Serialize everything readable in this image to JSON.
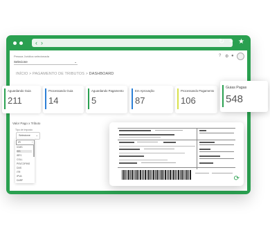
{
  "browser": {
    "nav_back": "‹",
    "nav_forward": "›",
    "toolbar_icons": [
      "reload-icon",
      "add-icon",
      "star-icon"
    ]
  },
  "header": {
    "profile_caption": "Pessoa Jurídica selecionada",
    "company_select_value": "Selecione",
    "icons": [
      "help-icon",
      "settings-icon",
      "notifications-icon"
    ]
  },
  "breadcrumb": {
    "items": [
      "INÍCIO",
      "PAGAMENTO DE TRIBUTOS"
    ],
    "separator": ">",
    "current": "DASHBOARD"
  },
  "cards": [
    {
      "label": "Aguardando Guia",
      "value": "211",
      "color": "#2aa050"
    },
    {
      "label": "Processando Guia",
      "value": "14",
      "color": "#2b7fd6"
    },
    {
      "label": "Aguardando Pagamento",
      "value": "5",
      "color": "#2aa050"
    },
    {
      "label": "Em Aprovação",
      "value": "87",
      "color": "#2b7fd6"
    },
    {
      "label": "Processando Pagamento",
      "value": "106",
      "color": "#d8e04a"
    },
    {
      "label": "Guias Pagas",
      "value": "548",
      "color": "#2aa050"
    }
  ],
  "filters": {
    "title": "Valor Pago x Tributo",
    "type_label": "Tipo de Imposto",
    "type_value": "Selecione",
    "dropdown_selected": "IPI",
    "dropdown_options": [
      "ICMS",
      "ISS",
      "IRPJ",
      "CSLL",
      "PIS/COFINS",
      "DAS",
      "ITR",
      "IPVA",
      "DARF"
    ]
  },
  "colors": {
    "brand_green": "#2aa050",
    "background": "#ffffff"
  }
}
